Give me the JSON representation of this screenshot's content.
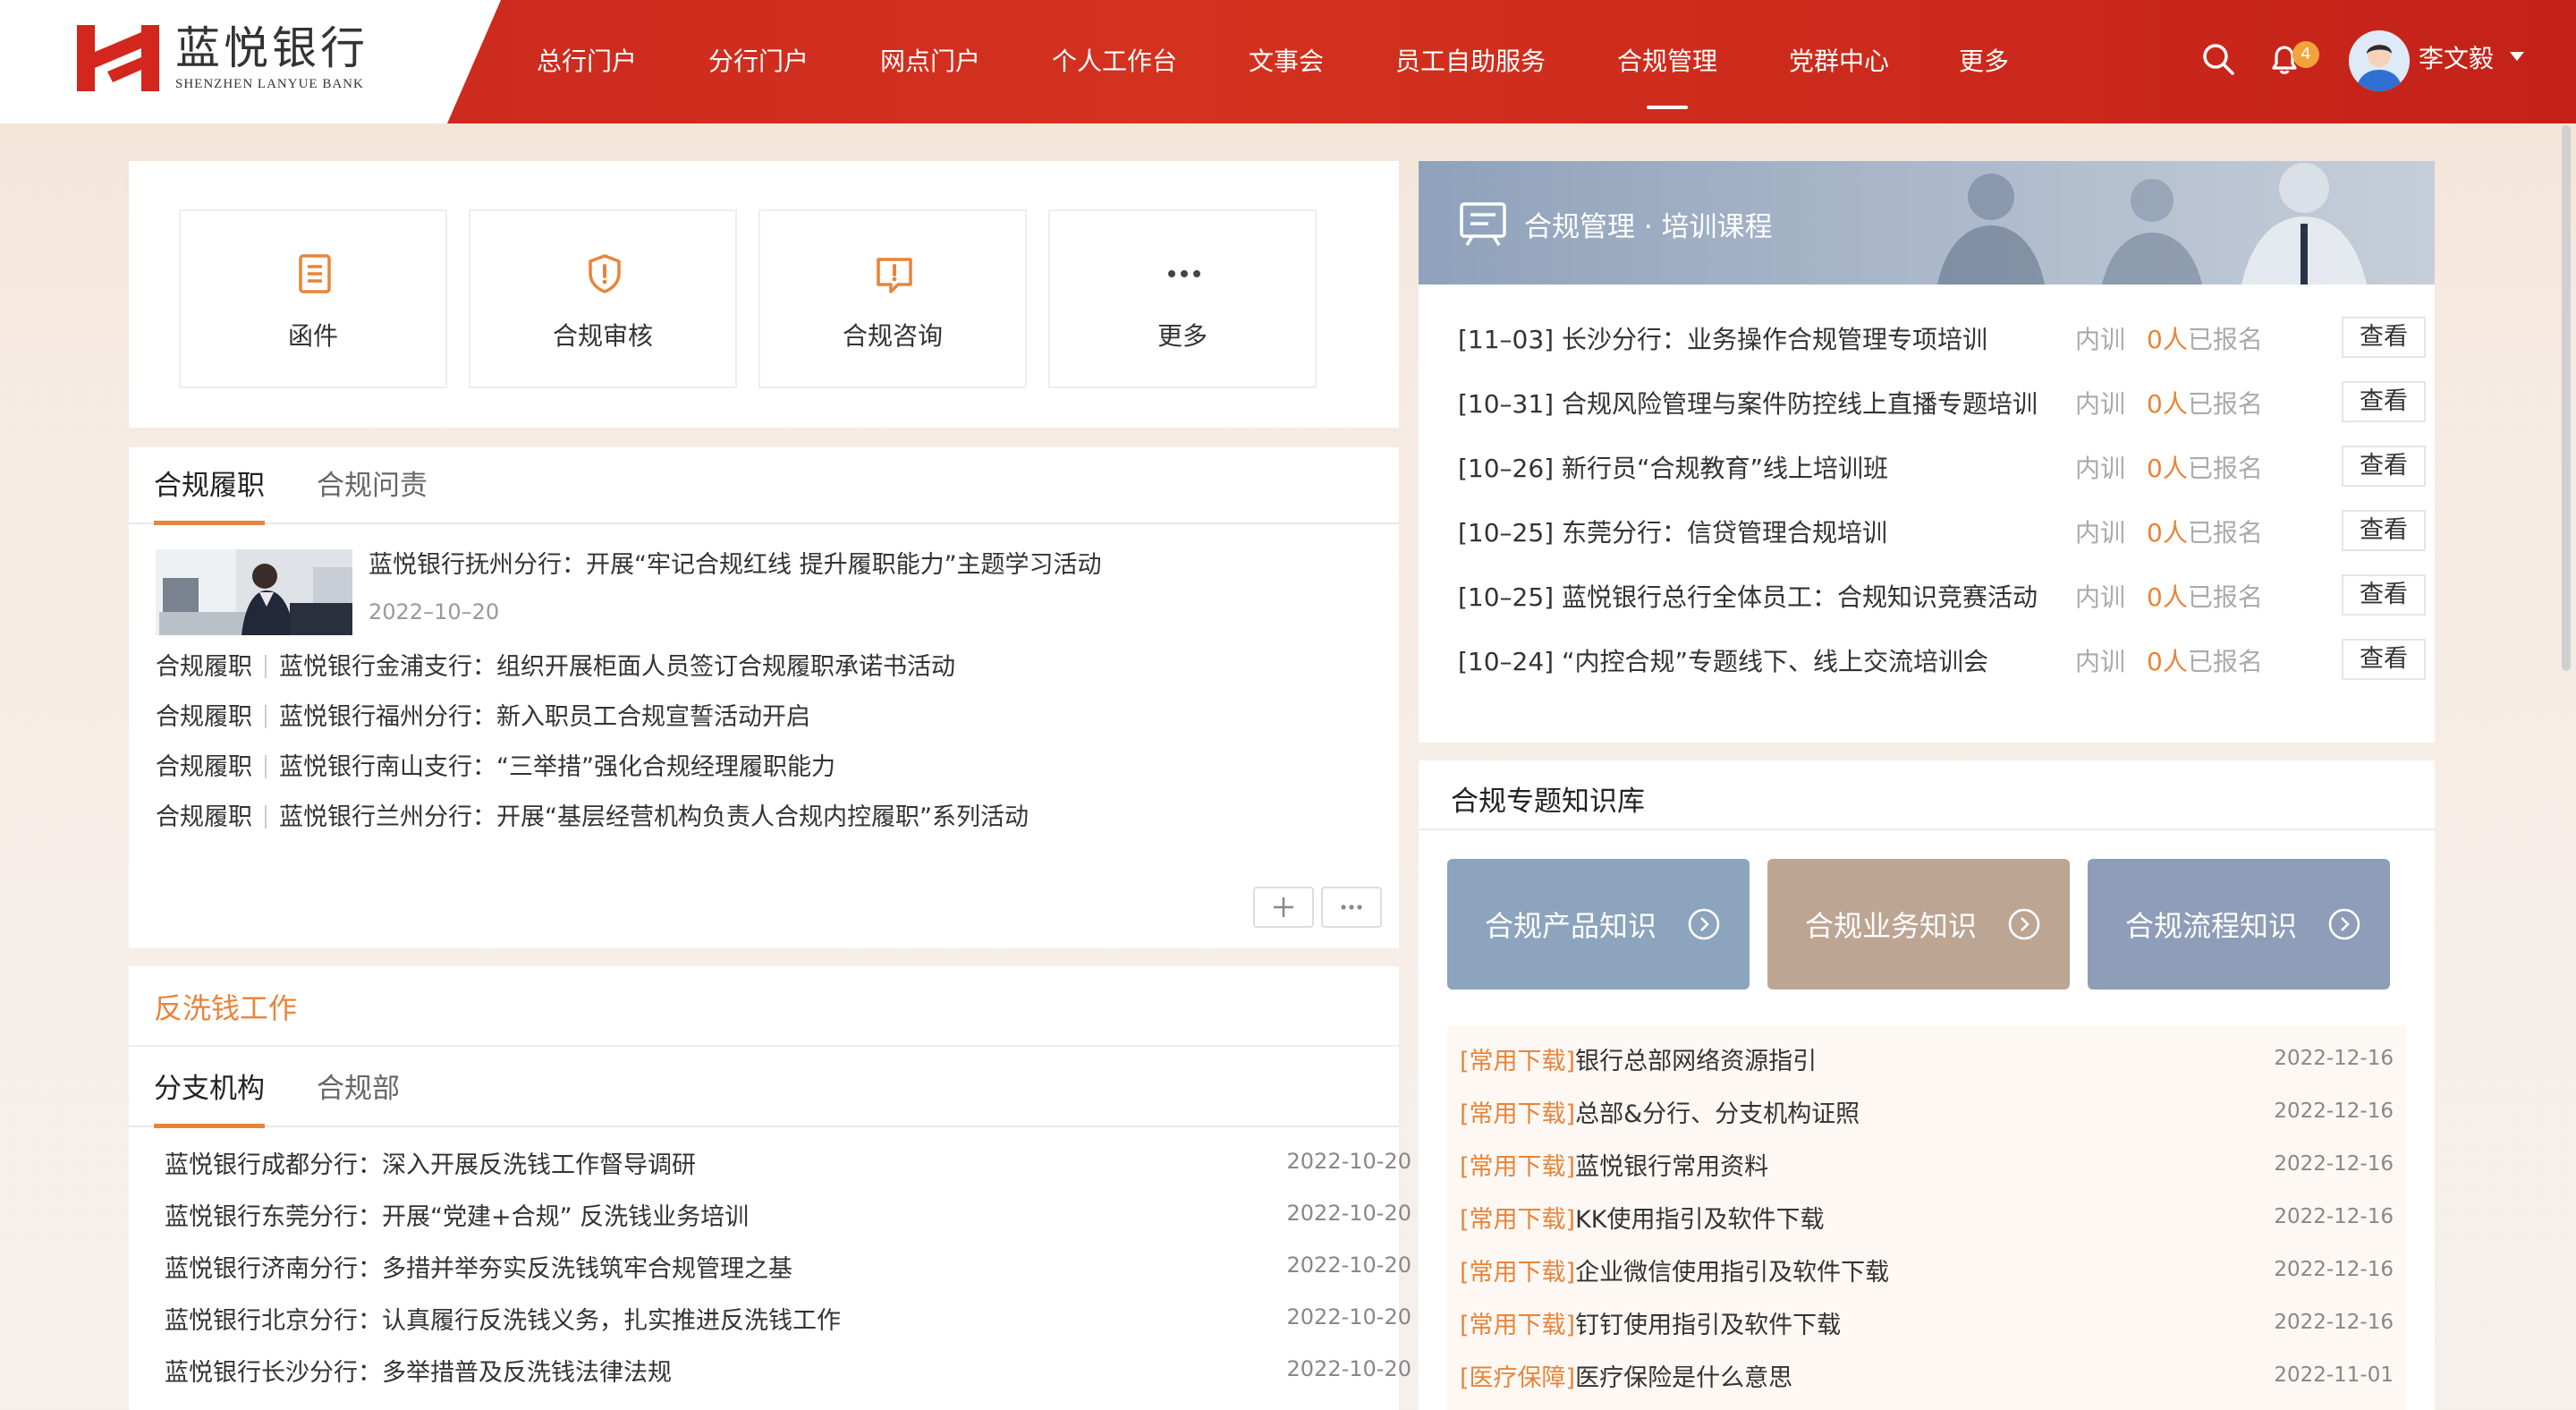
{
  "brand": {
    "name": "蓝悦银行",
    "subtitle": "SHENZHEN LANYUE BANK",
    "color": "#c8261d"
  },
  "nav": {
    "items": [
      "总行门户",
      "分行门户",
      "网点门户",
      "个人工作台",
      "文事会",
      "员工自助服务",
      "合规管理",
      "党群中心",
      "更多"
    ],
    "active": "合规管理"
  },
  "header_icons": {
    "search": "search-icon",
    "bell": "bell-icon",
    "notification_count": "4"
  },
  "user": {
    "name": "李文毅"
  },
  "quick_links": [
    {
      "label": "函件",
      "icon": "document-icon"
    },
    {
      "label": "合规审核",
      "icon": "shield-icon"
    },
    {
      "label": "合规咨询",
      "icon": "message-alert-icon"
    },
    {
      "label": "更多",
      "icon": "more-dots-icon"
    }
  ],
  "duty": {
    "tabs": [
      "合规履职",
      "合规问责"
    ],
    "featured": {
      "title": "蓝悦银行抚州分行：开展“牢记合规红线 提升履职能力”主题学习活动",
      "date": "2022–10–20"
    },
    "items": [
      {
        "tag": "合规履职",
        "title": "蓝悦银行金浦支行：组织开展柜面人员签订合规履职承诺书活动"
      },
      {
        "tag": "合规履职",
        "title": "蓝悦银行福州分行：新入职员工合规宣誓活动开启"
      },
      {
        "tag": "合规履职",
        "title": "蓝悦银行南山支行：“三举措”强化合规经理履职能力"
      },
      {
        "tag": "合规履职",
        "title": "蓝悦银行兰州分行：开展“基层经营机构负责人合规内控履职”系列活动"
      }
    ]
  },
  "aml": {
    "title": "反洗钱工作",
    "tabs": [
      "分支机构",
      "合规部"
    ],
    "items": [
      {
        "title": "蓝悦银行成都分行：深入开展反洗钱工作督导调研",
        "date": "2022-10-20"
      },
      {
        "title": "蓝悦银行东莞分行：开展“党建+合规” 反洗钱业务培训",
        "date": "2022-10-20"
      },
      {
        "title": "蓝悦银行济南分行：多措并举夯实反洗钱筑牢合规管理之基",
        "date": "2022-10-20"
      },
      {
        "title": "蓝悦银行北京分行：认真履行反洗钱义务，扎实推进反洗钱工作",
        "date": "2022-10-20"
      },
      {
        "title": "蓝悦银行长沙分行：多举措普及反洗钱法律法规",
        "date": "2022-10-20"
      }
    ]
  },
  "training": {
    "title": "合规管理 · 培训课程",
    "type_label": "内训",
    "enroll_suffix": "已报名",
    "view_label": "查看",
    "items": [
      {
        "title": "[11–03] 长沙分行：业务操作合规管理专项培训",
        "count": "0人"
      },
      {
        "title": "[10–31] 合规风险管理与案件防控线上直播专题培训",
        "count": "0人"
      },
      {
        "title": "[10–26] 新行员“合规教育”线上培训班",
        "count": "0人"
      },
      {
        "title": "[10–25] 东莞分行：信贷管理合规培训",
        "count": "0人"
      },
      {
        "title": "[10–25] 蓝悦银行总行全体员工：合规知识竞赛活动",
        "count": "0人"
      },
      {
        "title": "[10–24] “内控合规”专题线下、线上交流培训会",
        "count": "0人"
      }
    ]
  },
  "knowledge": {
    "title": "合规专题知识库",
    "cards": [
      {
        "label": "合规产品知识",
        "color": "#8ca4bd"
      },
      {
        "label": "合规业务知识",
        "color": "#bda593"
      },
      {
        "label": "合规流程知识",
        "color": "#8e9db8"
      }
    ],
    "downloads": [
      {
        "tag": "[常用下载]",
        "title": "银行总部网络资源指引",
        "date": "2022-12-16"
      },
      {
        "tag": "[常用下载]",
        "title": "总部&分行、分支机构证照",
        "date": "2022-12-16"
      },
      {
        "tag": "[常用下载]",
        "title": "蓝悦银行常用资料",
        "date": "2022-12-16"
      },
      {
        "tag": "[常用下载]",
        "title": "KK使用指引及软件下载",
        "date": "2022-12-16"
      },
      {
        "tag": "[常用下载]",
        "title": "企业微信使用指引及软件下载",
        "date": "2022-12-16"
      },
      {
        "tag": "[常用下载]",
        "title": "钉钉使用指引及软件下载",
        "date": "2022-12-16"
      },
      {
        "tag": "[医疗保障]",
        "title": "医疗保险是什么意思",
        "date": "2022-11-01"
      }
    ]
  }
}
